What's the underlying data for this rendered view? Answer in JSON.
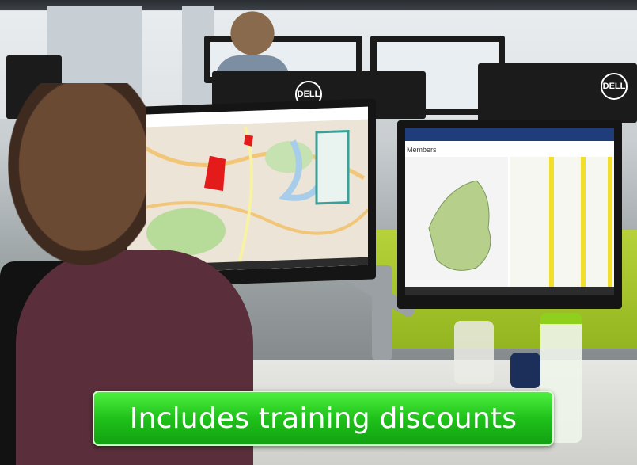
{
  "scene": {
    "monitor_brand": "DELL",
    "left_monitor_content": "street-map",
    "right_monitor_content": "europe-map-members",
    "right_screen_heading": "Members"
  },
  "banner": {
    "text": "Includes training discounts"
  },
  "colors": {
    "banner_green": "#22c81c",
    "partition_green": "#a6c52d",
    "map_red": "#e41b1b"
  }
}
